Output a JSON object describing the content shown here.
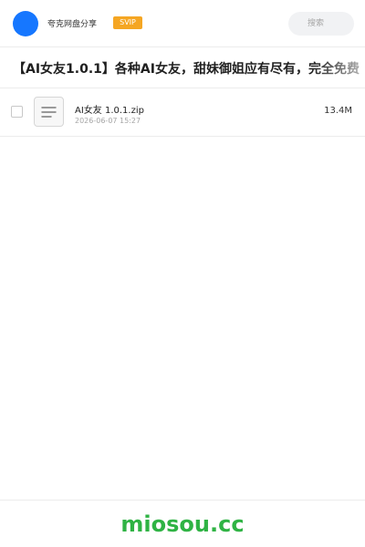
{
  "header": {
    "user_name": "夸克网盘分享",
    "badge": "SVIP",
    "search_label": "搜索"
  },
  "share": {
    "title": "【AI女友1.0.1】各种AI女友，甜妹御姐应有尽有，完全免费"
  },
  "files": [
    {
      "name": "AI女友 1.0.1.zip",
      "date": "2026-06-07 15:27",
      "size": "13.4M",
      "icon": "file-icon"
    }
  ],
  "footer": {
    "brand": "miosou.cc"
  },
  "colors": {
    "accent": "#1677ff",
    "badge": "#f5a623",
    "brand": "#2fb344"
  }
}
